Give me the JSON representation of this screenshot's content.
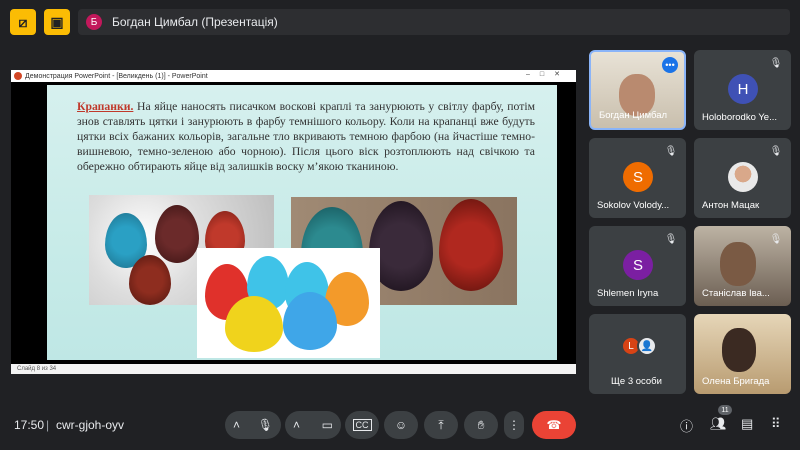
{
  "topbar": {
    "presenter_initial": "Б",
    "presenter_label": "Богдан Цимбал (Презентація)",
    "colors": {
      "accent": "#fbbc04",
      "avatar": "#c2185b"
    }
  },
  "powerpoint": {
    "title": "Демонстрация PowerPoint - [Великдень (1)] - PowerPoint",
    "status": "Слайд 8 из 34"
  },
  "slide": {
    "keyword": "Крапанки.",
    "body": " На яйце наносять писачком воскові краплі та занурюють у світлу фарбу, потім знов ставлять цятки і занурюють в фарбу темнішого кольору. Коли на крапанці вже будуть цятки всіх бажаних кольорів, загальне тло вкривають темною фарбою (на йчастіше темно-вишневою, темно-зеленою або чорною). Після цього віск розтоплюють над свічкою та обережно обтирають яйце від залишків воску м’якою тканиною."
  },
  "participants": [
    {
      "name": "Богдан Цимбал",
      "type": "video",
      "self": true
    },
    {
      "name": "Holoborodko Ye...",
      "initial": "H",
      "color": "#3f51b5",
      "muted": true
    },
    {
      "name": "Sokolov Volody...",
      "initial": "S",
      "color": "#ef6c00",
      "muted": true
    },
    {
      "name": "Антон Мацак",
      "type": "photo",
      "muted": true
    },
    {
      "name": "Shlemen Iryna",
      "initial": "S",
      "color": "#7b1fa2",
      "muted": true
    },
    {
      "name": "Станіслав Іва...",
      "type": "video",
      "muted": true
    },
    {
      "name": "Ще 3 особи",
      "avatars": [
        "L",
        "👤"
      ]
    },
    {
      "name": "Олена Бригада",
      "type": "video"
    }
  ],
  "bottombar": {
    "time": "17:50",
    "separator": "|",
    "meeting_code": "cwr-gjoh-oyv",
    "participant_count": "11"
  },
  "icons": {
    "topbar": [
      "hide-self-icon",
      "trash-icon"
    ],
    "controls": [
      "chevron-up-icon",
      "mic-icon",
      "chevron-up-icon",
      "camera-icon",
      "captions-icon",
      "emoji-icon",
      "present-icon",
      "raise-hand-icon",
      "more-icon",
      "end-call-icon"
    ],
    "right": [
      "info-icon",
      "people-icon",
      "chat-icon",
      "activities-icon"
    ]
  }
}
